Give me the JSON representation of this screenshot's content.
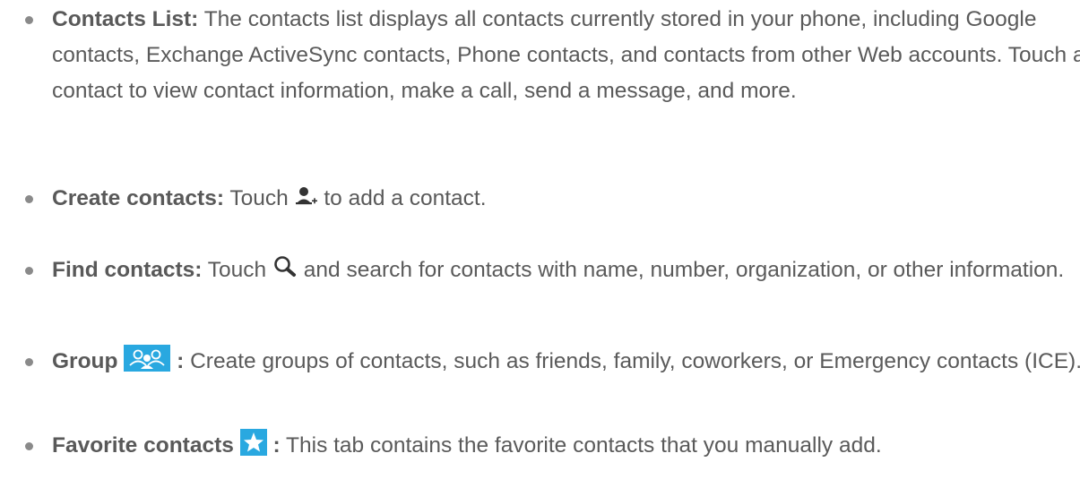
{
  "items": [
    {
      "term": "Contacts List:",
      "text": " The contacts list displays all contacts currently stored in your phone, including Google contacts, Exchange ActiveSync contacts, Phone contacts, and contacts from other Web accounts. Touch a contact to view contact information, make a call, send a message, and more."
    },
    {
      "term": "Create contacts:",
      "before_icon": " Touch ",
      "icon": "add-contact-icon",
      "after_icon": " to add a contact."
    },
    {
      "term": "Find contacts:",
      "before_icon": " Touch ",
      "icon": "search-icon",
      "after_icon": " and search for contacts with name, number, organization, or other information."
    },
    {
      "term": "Group",
      "icon": "group-icon",
      "term_suffix": ":",
      "text": " Create groups of contacts, such as friends, family, coworkers, or Emergency contacts (ICE)."
    },
    {
      "term": "Favorite contacts",
      "icon": "favorite-star-icon",
      "term_suffix": ":",
      "text": " This tab contains the favorite contacts that you manually add."
    }
  ],
  "colors": {
    "text": "#5a5a5a",
    "bullet": "#8a8a8a",
    "icon_blue": "#29a8e0"
  }
}
